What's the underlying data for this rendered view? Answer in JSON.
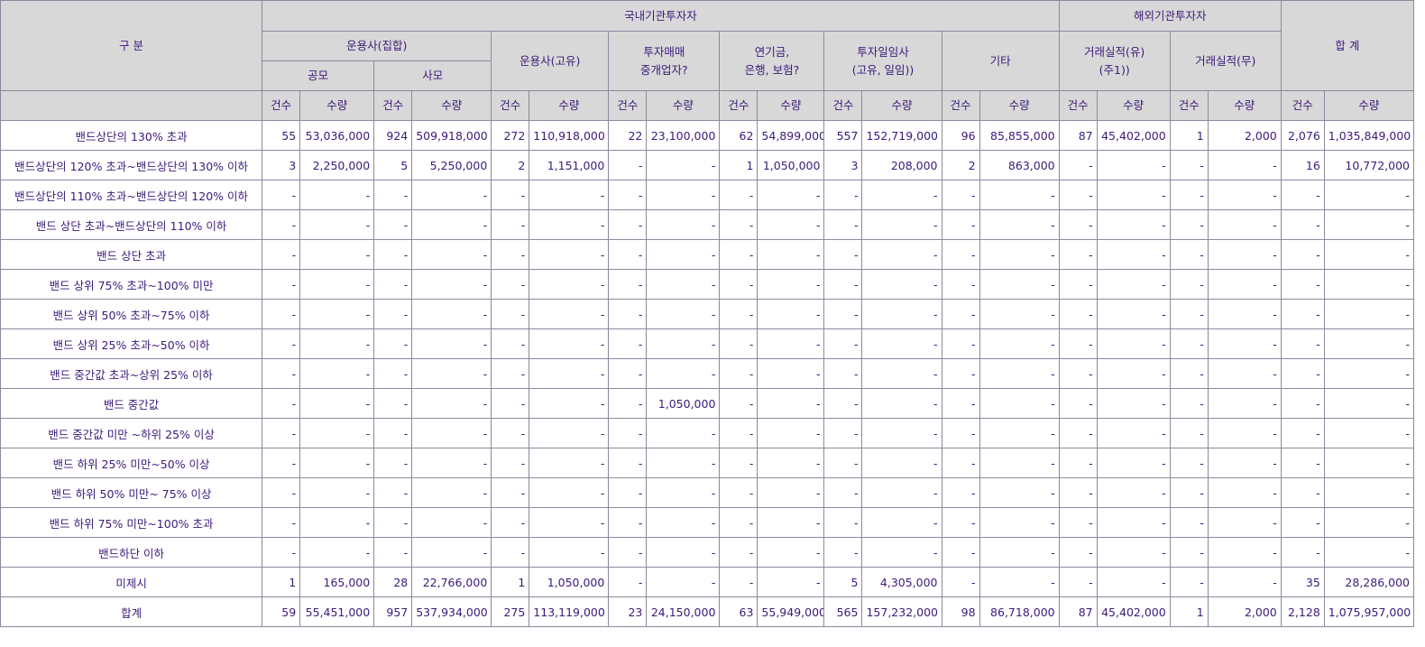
{
  "header": {
    "category": "구 분",
    "domestic": "국내기관투자자",
    "foreign": "해외기관투자자",
    "total": "합 계",
    "am_collective": "운용사(집합)",
    "public": "공모",
    "private": "사모",
    "am_proprietary": "운용사(고유)",
    "broker": "투자매매\n중개업자?",
    "pension": "연기금,\n은행, 보험?",
    "discretionary": "투자일임사\n(고유, 일임))",
    "other": "기타",
    "trade_yes": "거래실적(유)\n(주1))",
    "trade_no": "거래실적(무)",
    "count_label": "건수",
    "qty_label": "수량"
  },
  "rows": [
    {
      "label": "밴드상단의 130% 초과",
      "cells": [
        "55",
        "53,036,000",
        "924",
        "509,918,000",
        "272",
        "110,918,000",
        "22",
        "23,100,000",
        "62",
        "54,899,000",
        "557",
        "152,719,000",
        "96",
        "85,855,000",
        "87",
        "45,402,000",
        "1",
        "2,000",
        "2,076",
        "1,035,849,000"
      ]
    },
    {
      "label": "밴드상단의 120% 초과~밴드상단의 130% 이하",
      "cells": [
        "3",
        "2,250,000",
        "5",
        "5,250,000",
        "2",
        "1,151,000",
        "-",
        "-",
        "1",
        "1,050,000",
        "3",
        "208,000",
        "2",
        "863,000",
        "-",
        "-",
        "-",
        "-",
        "16",
        "10,772,000"
      ]
    },
    {
      "label": "밴드상단의 110% 초과~밴드상단의 120% 이하",
      "cells": [
        "-",
        "-",
        "-",
        "-",
        "-",
        "-",
        "-",
        "-",
        "-",
        "-",
        "-",
        "-",
        "-",
        "-",
        "-",
        "-",
        "-",
        "-",
        "-",
        "-"
      ]
    },
    {
      "label": "밴드 상단 초과~밴드상단의 110% 이하",
      "cells": [
        "-",
        "-",
        "-",
        "-",
        "-",
        "-",
        "-",
        "-",
        "-",
        "-",
        "-",
        "-",
        "-",
        "-",
        "-",
        "-",
        "-",
        "-",
        "-",
        "-"
      ]
    },
    {
      "label": "밴드 상단 초과",
      "cells": [
        "-",
        "-",
        "-",
        "-",
        "-",
        "-",
        "-",
        "-",
        "-",
        "-",
        "-",
        "-",
        "-",
        "-",
        "-",
        "-",
        "-",
        "-",
        "-",
        "-"
      ]
    },
    {
      "label": "밴드 상위 75% 초과~100% 미만",
      "cells": [
        "-",
        "-",
        "-",
        "-",
        "-",
        "-",
        "-",
        "-",
        "-",
        "-",
        "-",
        "-",
        "-",
        "-",
        "-",
        "-",
        "-",
        "-",
        "-",
        "-"
      ]
    },
    {
      "label": "밴드 상위 50% 초과~75% 이하",
      "cells": [
        "-",
        "-",
        "-",
        "-",
        "-",
        "-",
        "-",
        "-",
        "-",
        "-",
        "-",
        "-",
        "-",
        "-",
        "-",
        "-",
        "-",
        "-",
        "-",
        "-"
      ]
    },
    {
      "label": "밴드 상위 25% 초과~50% 이하",
      "cells": [
        "-",
        "-",
        "-",
        "-",
        "-",
        "-",
        "-",
        "-",
        "-",
        "-",
        "-",
        "-",
        "-",
        "-",
        "-",
        "-",
        "-",
        "-",
        "-",
        "-"
      ]
    },
    {
      "label": "밴드 중간값 초과~상위 25% 이하",
      "cells": [
        "-",
        "-",
        "-",
        "-",
        "-",
        "-",
        "-",
        "-",
        "-",
        "-",
        "-",
        "-",
        "-",
        "-",
        "-",
        "-",
        "-",
        "-",
        "-",
        "-"
      ]
    },
    {
      "label": "밴드 중간값",
      "cells": [
        "-",
        "-",
        "-",
        "-",
        "-",
        "-",
        "-",
        "1,050,000",
        "-",
        "-",
        "-",
        "-",
        "-",
        "-",
        "-",
        "-",
        "-",
        "-",
        "-",
        "-"
      ]
    },
    {
      "label": "밴드 중간값 미만 ~하위 25% 이상",
      "cells": [
        "-",
        "-",
        "-",
        "-",
        "-",
        "-",
        "-",
        "-",
        "-",
        "-",
        "-",
        "-",
        "-",
        "-",
        "-",
        "-",
        "-",
        "-",
        "-",
        "-"
      ]
    },
    {
      "label": "밴드 하위 25% 미만~50% 이상",
      "cells": [
        "-",
        "-",
        "-",
        "-",
        "-",
        "-",
        "-",
        "-",
        "-",
        "-",
        "-",
        "-",
        "-",
        "-",
        "-",
        "-",
        "-",
        "-",
        "-",
        "-"
      ]
    },
    {
      "label": "밴드 하위 50% 미만~ 75% 이상",
      "cells": [
        "-",
        "-",
        "-",
        "-",
        "-",
        "-",
        "-",
        "-",
        "-",
        "-",
        "-",
        "-",
        "-",
        "-",
        "-",
        "-",
        "-",
        "-",
        "-",
        "-"
      ]
    },
    {
      "label": "밴드 하위 75% 미만~100% 초과",
      "cells": [
        "-",
        "-",
        "-",
        "-",
        "-",
        "-",
        "-",
        "-",
        "-",
        "-",
        "-",
        "-",
        "-",
        "-",
        "-",
        "-",
        "-",
        "-",
        "-",
        "-"
      ]
    },
    {
      "label": "밴드하단 이하",
      "cells": [
        "-",
        "-",
        "-",
        "-",
        "-",
        "-",
        "-",
        "-",
        "-",
        "-",
        "-",
        "-",
        "-",
        "-",
        "-",
        "-",
        "-",
        "-",
        "-",
        "-"
      ]
    },
    {
      "label": "미제시",
      "cells": [
        "1",
        "165,000",
        "28",
        "22,766,000",
        "1",
        "1,050,000",
        "-",
        "-",
        "-",
        "-",
        "5",
        "4,305,000",
        "-",
        "-",
        "-",
        "-",
        "-",
        "-",
        "35",
        "28,286,000"
      ]
    },
    {
      "label": "합계",
      "cells": [
        "59",
        "55,451,000",
        "957",
        "537,934,000",
        "275",
        "113,119,000",
        "23",
        "24,150,000",
        "63",
        "55,949,000",
        "565",
        "157,232,000",
        "98",
        "86,718,000",
        "87",
        "45,402,000",
        "1",
        "2,000",
        "2,128",
        "1,075,957,000"
      ]
    }
  ]
}
